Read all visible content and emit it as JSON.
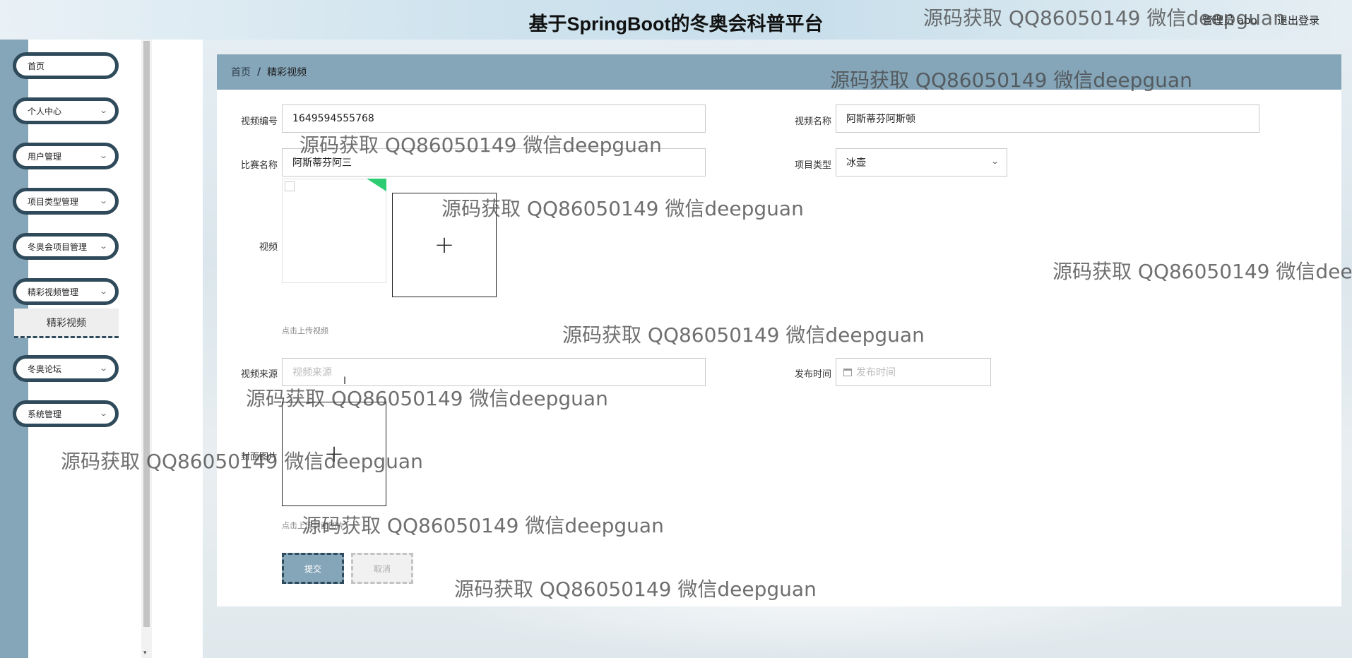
{
  "header": {
    "title": "基于SpringBoot的冬奥会科普平台",
    "user_info": "管理员 abo",
    "logout_label": "退出登录"
  },
  "sidebar": {
    "items": [
      {
        "label": "首页",
        "has_arrow": false
      },
      {
        "label": "个人中心",
        "has_arrow": true
      },
      {
        "label": "用户管理",
        "has_arrow": true
      },
      {
        "label": "项目类型管理",
        "has_arrow": true
      },
      {
        "label": "冬奥会项目管理",
        "has_arrow": true
      },
      {
        "label": "精彩视频管理",
        "has_arrow": true
      },
      {
        "label": "冬奥论坛",
        "has_arrow": true
      },
      {
        "label": "系统管理",
        "has_arrow": true
      }
    ],
    "active_sub_item": "精彩视频",
    "scroll_arrow": "▾"
  },
  "breadcrumb": {
    "home": "首页",
    "separator": "/",
    "current": "精彩视频"
  },
  "form": {
    "video_id": {
      "label": "视频编号",
      "value": "1649594555768"
    },
    "video_name": {
      "label": "视频名称",
      "value": "阿斯蒂芬阿斯顿"
    },
    "match_name": {
      "label": "比赛名称",
      "value": "阿斯蒂芬阿三"
    },
    "project_type": {
      "label": "项目类型",
      "value": "冰壶"
    },
    "video": {
      "label": "视频",
      "upload_hint": "点击上传视频"
    },
    "video_source": {
      "label": "视频来源",
      "placeholder": "视频来源"
    },
    "publish_time": {
      "label": "发布时间",
      "placeholder": "发布时间"
    },
    "cover_image": {
      "label": "封面图片",
      "upload_hint": "点击上传封面图片"
    },
    "submit_label": "提交",
    "cancel_label": "取消",
    "upload_plus": "+"
  },
  "watermark_text": "源码获取 QQ86050149 微信deepguan",
  "colors": {
    "accent": "#85a6b9",
    "menu_border": "#2f4a5a",
    "success": "#2ecc71"
  }
}
